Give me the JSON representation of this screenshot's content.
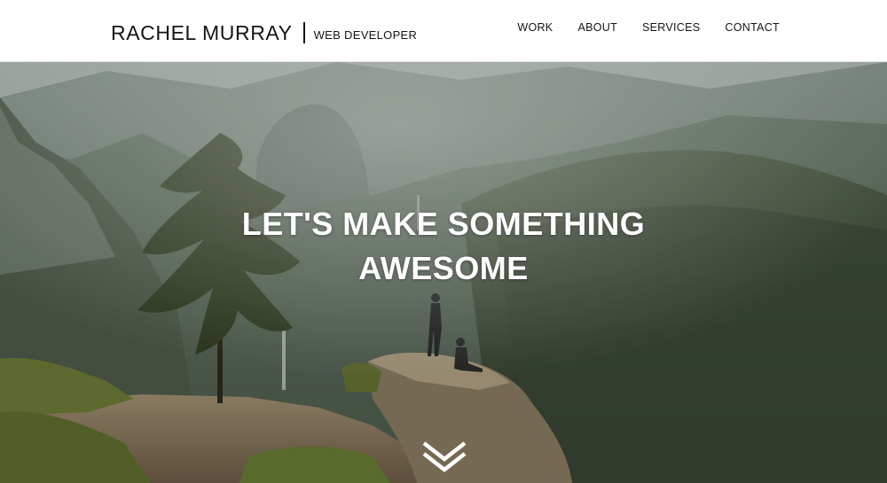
{
  "header": {
    "brand_name": "RACHEL MURRAY",
    "brand_role": "WEB DEVELOPER"
  },
  "nav": {
    "items": [
      {
        "label": "WORK"
      },
      {
        "label": "ABOUT"
      },
      {
        "label": "SERVICES"
      },
      {
        "label": "CONTACT"
      }
    ]
  },
  "hero": {
    "title_line1": "LET'S MAKE SOMETHING",
    "title_line2": "AWESOME",
    "background_image": "mountain-valley-photo",
    "scroll_icon": "double-chevron-down-icon"
  },
  "colors": {
    "header_bg": "#ffffff",
    "text_dark": "#151515",
    "hero_text": "#ffffff"
  }
}
